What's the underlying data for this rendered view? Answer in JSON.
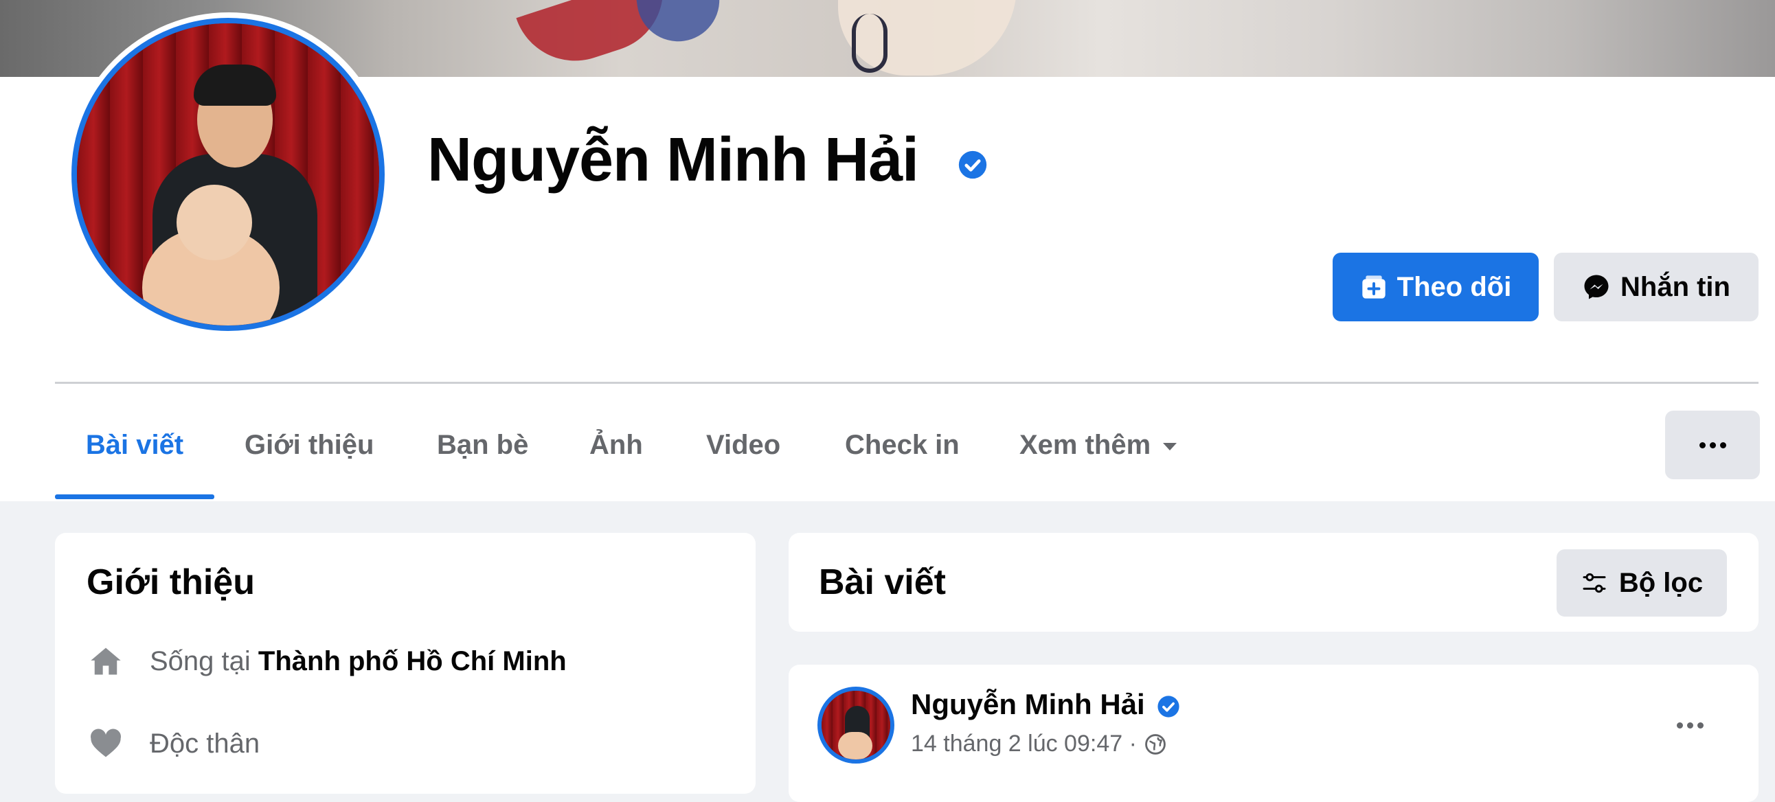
{
  "profile": {
    "name": "Nguyễn Minh Hải",
    "verified": true
  },
  "actions": {
    "follow_label": "Theo dõi",
    "message_label": "Nhắn tin"
  },
  "tabs": [
    {
      "label": "Bài viết",
      "active": true
    },
    {
      "label": "Giới thiệu",
      "active": false
    },
    {
      "label": "Bạn bè",
      "active": false
    },
    {
      "label": "Ảnh",
      "active": false
    },
    {
      "label": "Video",
      "active": false
    },
    {
      "label": "Check in",
      "active": false
    },
    {
      "label": "Xem thêm",
      "active": false
    }
  ],
  "intro": {
    "title": "Giới thiệu",
    "lives_prefix": "Sống tại",
    "lives_place": "Thành phố Hồ Chí Minh",
    "relationship": "Độc thân"
  },
  "posts": {
    "title": "Bài viết",
    "filter_label": "Bộ lọc"
  },
  "post": {
    "author": "Nguyễn Minh Hải",
    "meta": "14 tháng 2 lúc 09:47 ·"
  },
  "colors": {
    "accent": "#1b74e4",
    "secondary_text": "#65676b",
    "button_gray": "#e4e6eb",
    "page_bg": "#f0f2f5"
  },
  "icons": {
    "verified": "verified-badge-icon",
    "follow": "follow-icon",
    "messenger": "messenger-icon",
    "caret": "caret-down-icon",
    "more": "ellipsis-icon",
    "home": "home-icon",
    "heart": "heart-icon",
    "filter": "filter-icon",
    "globe": "globe-icon"
  }
}
